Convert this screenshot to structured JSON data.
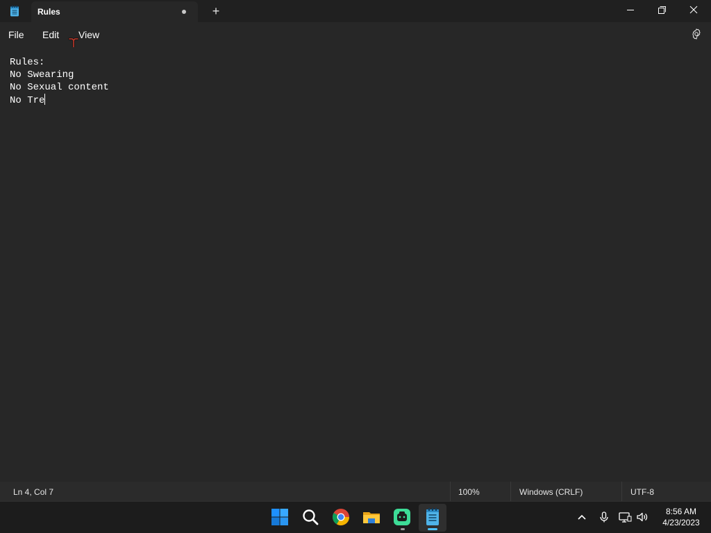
{
  "window": {
    "tab_title": "Rules",
    "new_tab_label": "+"
  },
  "menu": {
    "file": "File",
    "edit": "Edit",
    "view": "View"
  },
  "document": {
    "lines": [
      "Rules:",
      "No Swearing",
      "No Sexual content",
      "No Tre"
    ]
  },
  "status": {
    "position": "Ln 4, Col 7",
    "zoom": "100%",
    "line_ending": "Windows (CRLF)",
    "encoding": "UTF-8"
  },
  "taskbar": {
    "pinned": [
      "start-icon",
      "search-icon",
      "chrome-icon",
      "file-explorer-icon",
      "app-icon",
      "notepad-icon"
    ],
    "clock_time": "8:56 AM",
    "clock_date": "4/23/2023"
  },
  "colors": {
    "background": "#202020",
    "editor": "#272727",
    "accent": "#4cc2ff"
  }
}
